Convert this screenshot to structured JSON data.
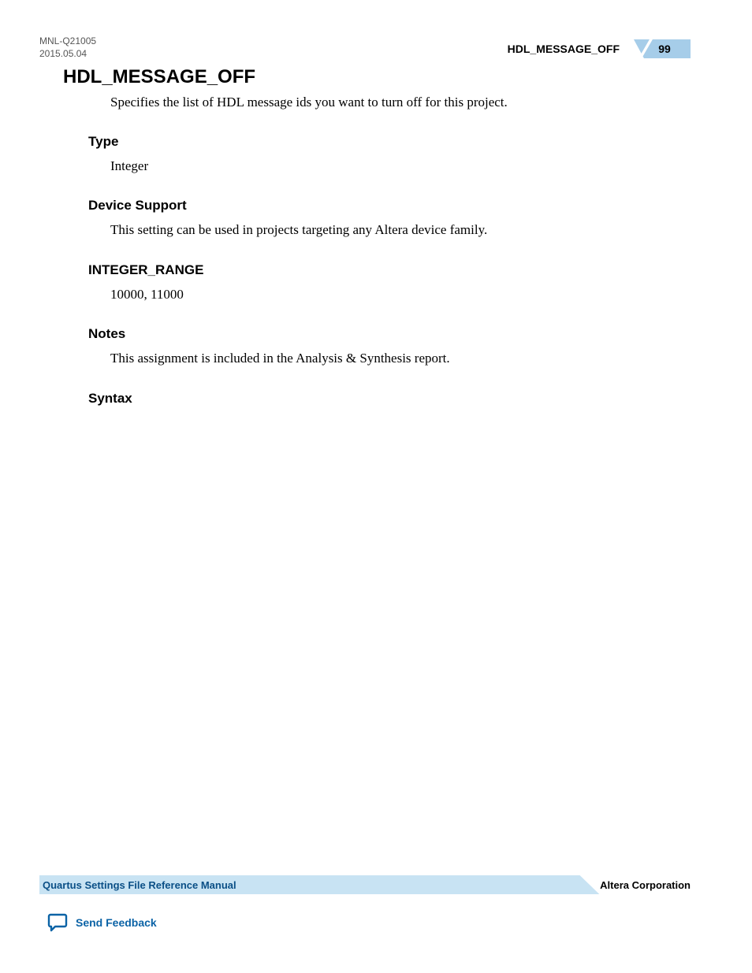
{
  "header": {
    "doc_id": "MNL-Q21005",
    "date": "2015.05.04",
    "section_name": "HDL_MESSAGE_OFF",
    "page_number": "99"
  },
  "main": {
    "title": "HDL_MESSAGE_OFF",
    "intro": "Specifies the list of HDL message ids you want to turn off for this project."
  },
  "sections": {
    "type": {
      "heading": "Type",
      "body": "Integer"
    },
    "device_support": {
      "heading": "Device Support",
      "body": "This setting can be used in projects targeting any Altera device family."
    },
    "integer_range": {
      "heading": "INTEGER_RANGE",
      "body": "10000, 11000"
    },
    "notes": {
      "heading": "Notes",
      "body": "This assignment is included in the Analysis & Synthesis report."
    },
    "syntax": {
      "heading": "Syntax"
    }
  },
  "footer": {
    "manual_title": "Quartus Settings File Reference Manual",
    "corporation": "Altera Corporation",
    "feedback_label": "Send Feedback"
  }
}
